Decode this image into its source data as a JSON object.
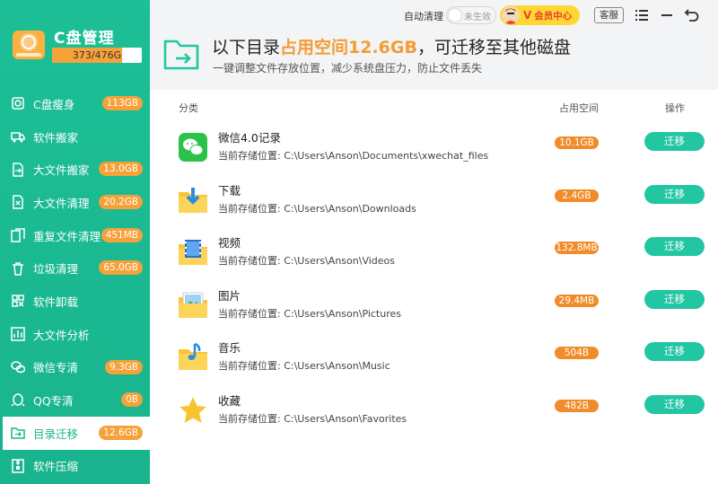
{
  "app": {
    "title": "C盘管理",
    "disk_usage": "373/476G",
    "usage_fraction": 0.78
  },
  "topbar": {
    "auto_clean_label": "自动清理",
    "toggle_state": "未生效",
    "vip_label": "会员中心",
    "vip_letter": "V",
    "support_label": "客服"
  },
  "sidebar": {
    "items": [
      {
        "label": "C盘瘦身",
        "badge": "113GB",
        "icon": "slim-icon"
      },
      {
        "label": "软件搬家",
        "badge": "",
        "icon": "truck-icon"
      },
      {
        "label": "大文件搬家",
        "badge": "13.0GB",
        "icon": "big-file-move-icon"
      },
      {
        "label": "大文件清理",
        "badge": "20.2GB",
        "icon": "big-file-clean-icon"
      },
      {
        "label": "重复文件清理",
        "badge": "451MB",
        "icon": "duplicate-file-icon"
      },
      {
        "label": "垃圾清理",
        "badge": "65.0GB",
        "icon": "trash-icon"
      },
      {
        "label": "软件卸载",
        "badge": "",
        "icon": "uninstall-icon"
      },
      {
        "label": "大文件分析",
        "badge": "",
        "icon": "analysis-icon"
      },
      {
        "label": "微信专清",
        "badge": "9.3GB",
        "icon": "wechat-icon"
      },
      {
        "label": "QQ专清",
        "badge": "0B",
        "icon": "qq-icon"
      },
      {
        "label": "目录迁移",
        "badge": "12.6GB",
        "icon": "dir-migrate-icon",
        "active": true
      },
      {
        "label": "软件压缩",
        "badge": "",
        "icon": "compress-icon"
      }
    ]
  },
  "header": {
    "pre": "以下目录",
    "highlight": "占用空间12.6GB",
    "post": "，可迁移至其他磁盘",
    "subtitle": "一键调整文件存放位置，减少系统盘压力，防止文件丢失"
  },
  "table": {
    "columns": {
      "category": "分类",
      "size": "占用空间",
      "action": "操作"
    },
    "path_prefix": "当前存储位置: ",
    "rows": [
      {
        "name": "微信4.0记录",
        "path": "当前存储位置:  C:\\Users\\Anson\\Documents\\xwechat_files",
        "size": "10.1GB",
        "action": "迁移",
        "icon": "wechat-icon"
      },
      {
        "name": "下载",
        "path": "当前存储位置:  C:\\Users\\Anson\\Downloads",
        "size": "2.4GB",
        "action": "迁移",
        "icon": "download-folder-icon"
      },
      {
        "name": "视频",
        "path": "当前存储位置:  C:\\Users\\Anson\\Videos",
        "size": "132.8MB",
        "action": "迁移",
        "icon": "video-folder-icon"
      },
      {
        "name": "图片",
        "path": "当前存储位置:  C:\\Users\\Anson\\Pictures",
        "size": "29.4MB",
        "action": "迁移",
        "icon": "picture-folder-icon"
      },
      {
        "name": "音乐",
        "path": "当前存储位置:  C:\\Users\\Anson\\Music",
        "size": "504B",
        "action": "迁移",
        "icon": "music-folder-icon"
      },
      {
        "name": "收藏",
        "path": "当前存储位置:  C:\\Users\\Anson\\Favorites",
        "size": "482B",
        "action": "迁移",
        "icon": "star-icon"
      }
    ]
  },
  "colors": {
    "accent": "#19b48d",
    "orange": "#f39c34",
    "button": "#22c6a2"
  }
}
